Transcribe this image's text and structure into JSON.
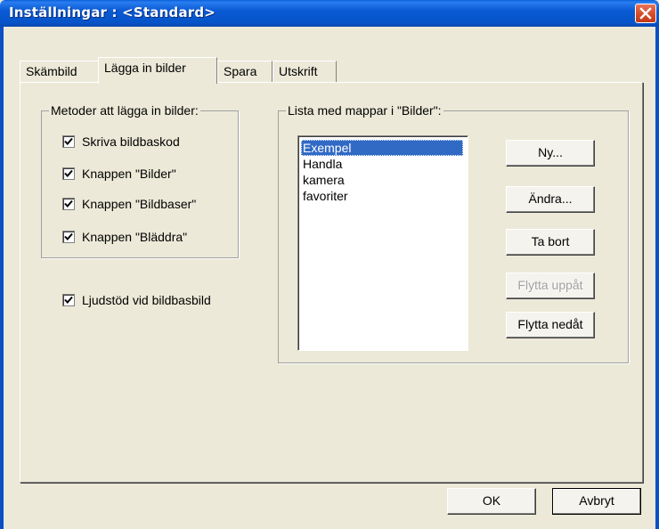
{
  "window": {
    "title": "Inställningar : <Standard>"
  },
  "tabs": [
    {
      "label": "Skämbild"
    },
    {
      "label": "Lägga in bilder"
    },
    {
      "label": "Spara"
    },
    {
      "label": "Utskrift"
    }
  ],
  "methods_group": {
    "label": "Metoder att lägga in bilder:",
    "options": [
      {
        "label": "Skriva bildbaskod",
        "checked": true
      },
      {
        "label": "Knappen \"Bilder\"",
        "checked": true
      },
      {
        "label": "Knappen \"Bildbaser\"",
        "checked": true
      },
      {
        "label": "Knappen \"Bläddra\"",
        "checked": true
      }
    ]
  },
  "sound_support": {
    "label": "Ljudstöd vid bildbasbild",
    "checked": true
  },
  "folders_group": {
    "label": "Lista med mappar i \"Bilder\":",
    "items": [
      "Exempel",
      "Handla",
      "kamera",
      "favoriter"
    ],
    "selected": "Exempel"
  },
  "folder_buttons": {
    "new": "Ny...",
    "edit": "Ändra...",
    "delete": "Ta bort",
    "move_up": "Flytta uppåt",
    "move_down": "Flytta nedåt"
  },
  "dialog_buttons": {
    "ok": "OK",
    "cancel": "Avbryt"
  }
}
